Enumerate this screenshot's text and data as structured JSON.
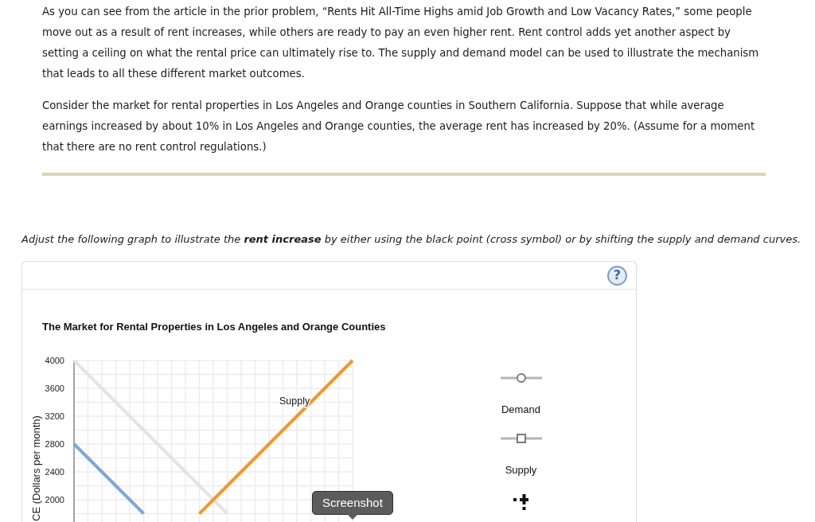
{
  "intro": {
    "paragraphs": [
      "As you can see from the article in the prior problem, “Rents Hit All-Time Highs amid Job Growth and Low Vacancy Rates,” some people move out as a result of rent increases, while others are ready to pay an even higher rent. Rent control adds yet another aspect by setting a ceiling on what the rental price can ultimately rise to. The supply and demand model can be used to illustrate the mechanism that leads to all these different market outcomes.",
      "Consider the market for rental properties in Los Angeles and Orange counties in Southern California. Suppose that while average earnings increased by about 10% in Los Angeles and Orange counties, the average rent has increased by 20%. (Assume for a moment that there are no rent control regulations.)"
    ]
  },
  "instruction": "Adjust the following graph to illustrate the **rent increase** by either using the black point (cross symbol) or by shifting the supply and demand curves.",
  "graph_panel": {
    "help_button": "?",
    "chart_data": [
      {
        "type": "line",
        "title": "The Market for Rental Properties in Los Angeles and Orange Counties",
        "ylabel": "CE (Dollars per month)",
        "categories": [
          null,
          null,
          null,
          null,
          null,
          null,
          null,
          null,
          null,
          null,
          null,
          null,
          null,
          null,
          null,
          null,
          null,
          null,
          null,
          null,
          null
        ],
        "ylim": [
          1680,
          4000
        ],
        "yticks": [
          2000,
          2400,
          2800,
          3200,
          3600,
          4000
        ],
        "tick_labels": "y",
        "grid": true,
        "series": [
          {
            "color": "#e4e4e4",
            "values": [
              4000,
              3800,
              3600,
              3400,
              3200,
              3000,
              2800,
              2600,
              2400,
              2200,
              2000,
              1800,
              null,
              null,
              null,
              null,
              null,
              null,
              null,
              null,
              null
            ]
          },
          {
            "color": "#7ea8cf",
            "values": [
              2800,
              2600,
              2400,
              2200,
              2000,
              1800,
              null,
              null,
              null,
              null,
              null,
              null,
              null,
              null,
              null,
              null,
              null,
              null,
              null,
              null,
              null
            ]
          },
          {
            "name": "Supply",
            "color": "#f7962c",
            "values": [
              null,
              null,
              null,
              null,
              null,
              null,
              null,
              null,
              null,
              1800,
              2000,
              2200,
              2400,
              2600,
              2800,
              3000,
              3200,
              3400,
              3600,
              3800,
              4000
            ]
          }
        ]
      }
    ],
    "tools": [
      {
        "kind": "circle",
        "label": "Demand"
      },
      {
        "kind": "square",
        "label": "Supply"
      },
      {
        "kind": "cross"
      }
    ]
  },
  "tooltip": {
    "text": "Screenshot"
  }
}
